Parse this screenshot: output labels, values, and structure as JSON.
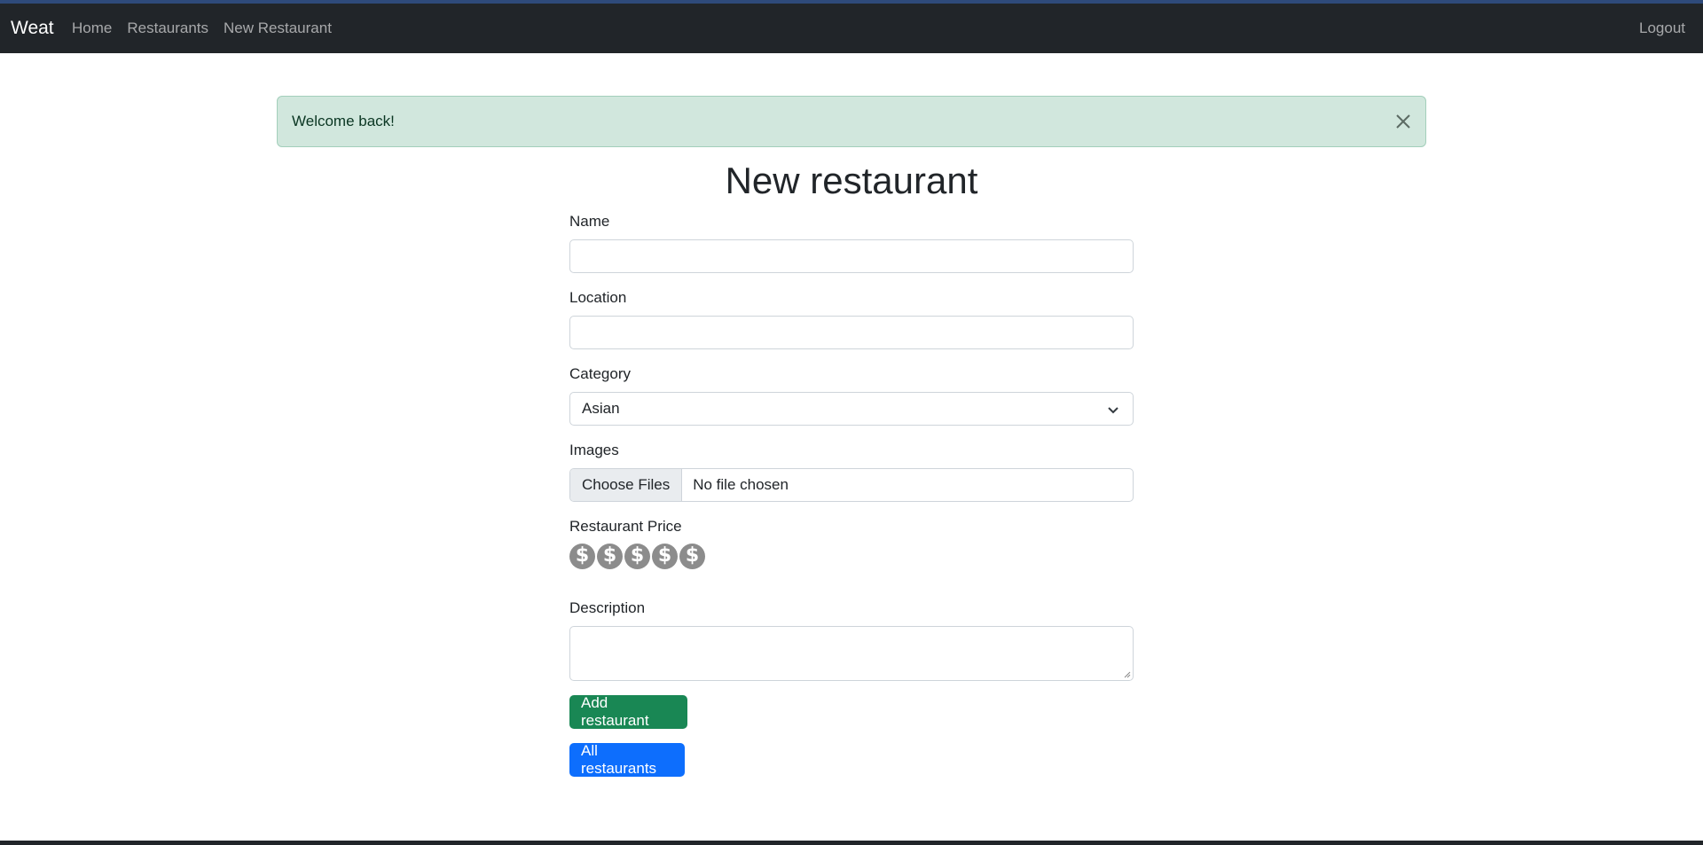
{
  "navbar": {
    "brand": "Weat",
    "links": [
      "Home",
      "Restaurants",
      "New Restaurant"
    ],
    "logout": "Logout"
  },
  "alert": {
    "message": "Welcome back!"
  },
  "page": {
    "title": "New restaurant"
  },
  "form": {
    "name_label": "Name",
    "name_value": "",
    "location_label": "Location",
    "location_value": "",
    "category_label": "Category",
    "category_selected": "Asian",
    "images_label": "Images",
    "images_button": "Choose Files",
    "images_status": "No file chosen",
    "price_label": "Restaurant Price",
    "price_symbol": "$",
    "price_rating": 0,
    "price_max": 5,
    "description_label": "Description",
    "description_value": "",
    "submit_label": "Add restaurant",
    "all_label": "All restaurants"
  },
  "colors": {
    "navbar": "#212529",
    "alert_bg": "#d1e7dd",
    "success": "#198754",
    "primary": "#0d6efd",
    "coin": "#8c8c8c"
  }
}
